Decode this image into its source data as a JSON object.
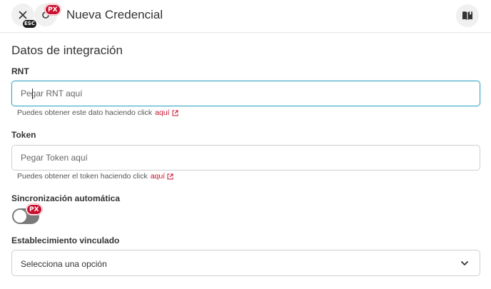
{
  "header": {
    "title": "Nueva Credencial",
    "esc_badge": "ESC",
    "px_badge": "PX"
  },
  "form": {
    "section_title": "Datos de integración",
    "rnt": {
      "label": "RNT",
      "placeholder": "Pegar RNT aquí",
      "value": "",
      "hint": "Puedes obtener este dato haciendo click",
      "hint_link": "aquí"
    },
    "token": {
      "label": "Token",
      "placeholder": "Pegar Token aquí",
      "value": "",
      "hint": "Puedes obtener el token haciendo click",
      "hint_link": "aquí"
    },
    "sync": {
      "label": "Sincronización automática",
      "px_badge": "PX",
      "enabled": false
    },
    "establishment": {
      "label": "Establecimiento vinculado",
      "selected": "Selecciona una opción"
    }
  },
  "colors": {
    "accent": "#3aa7c6",
    "brand": "#c8102e",
    "toggle_off": "#7a7a7a"
  },
  "icons": {
    "close": "close-icon",
    "sync": "sync-icon",
    "book": "book-icon",
    "external_link": "external-link-icon",
    "chevron": "chevron-down-icon"
  }
}
